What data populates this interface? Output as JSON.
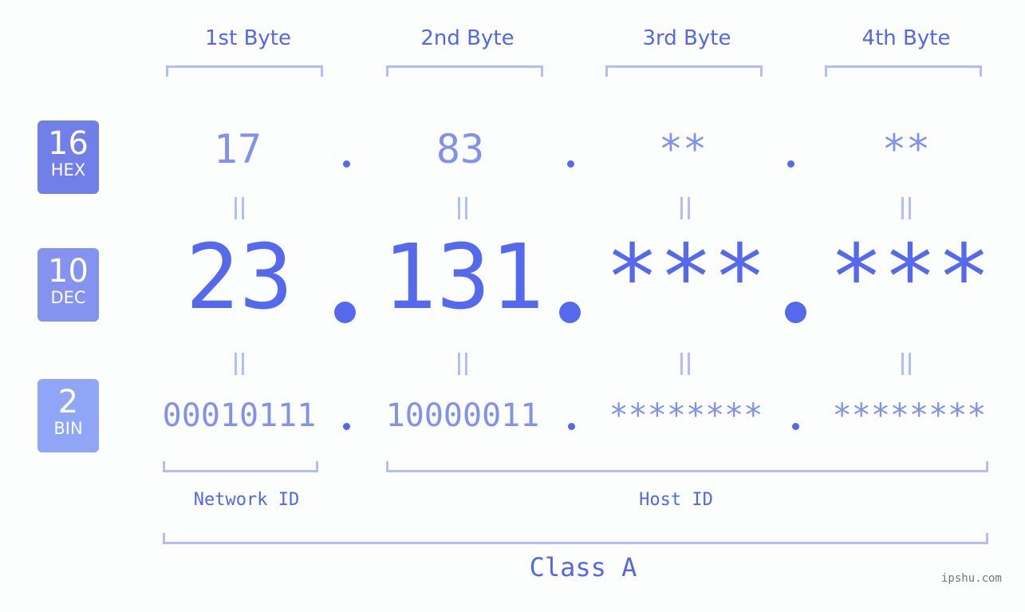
{
  "headers": [
    "1st Byte",
    "2nd Byte",
    "3rd Byte",
    "4th Byte"
  ],
  "badges": [
    {
      "number": "16",
      "label": "HEX",
      "color": "#7080e8"
    },
    {
      "number": "10",
      "label": "DEC",
      "color": "#8492f0"
    },
    {
      "number": "2",
      "label": "BIN",
      "color": "#8fa5f5"
    }
  ],
  "hex": [
    "17",
    "83",
    "**",
    "**"
  ],
  "dec": [
    "23",
    "131",
    "***",
    "***"
  ],
  "bin": [
    "00010111",
    "10000011",
    "********",
    "********"
  ],
  "network_label": "Network ID",
  "host_label": "Host ID",
  "class_label": "Class A",
  "watermark": "ipshu.com",
  "colors": {
    "primary": "#5469ec",
    "secondary": "#8291ea",
    "bracket": "#b3bdf8"
  }
}
